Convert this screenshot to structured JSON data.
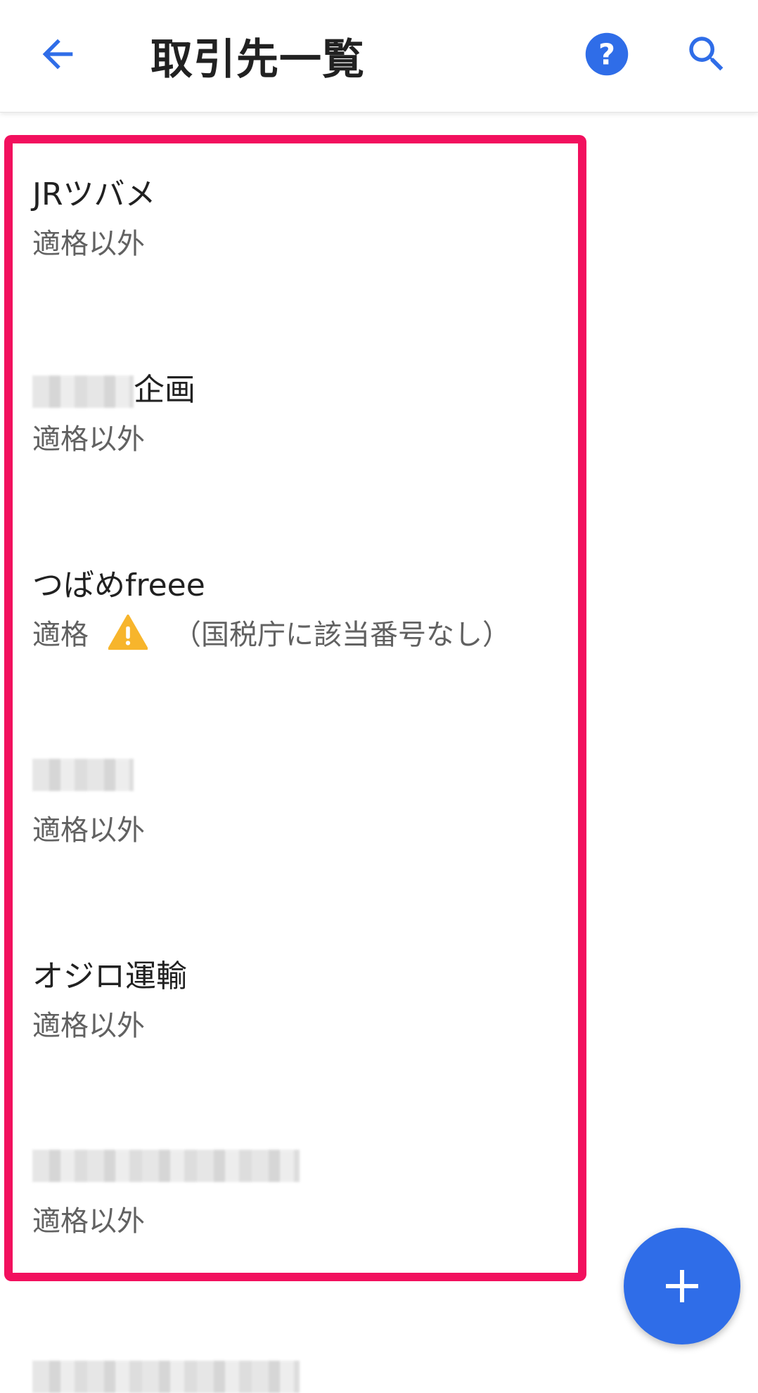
{
  "header": {
    "title": "取引先一覧"
  },
  "items": [
    {
      "name": "JRツバメ",
      "status": "適格以外"
    },
    {
      "name_suffix": "企画",
      "status": "適格以外"
    },
    {
      "name": "つばめfreee",
      "status": "適格",
      "note": "（国税庁に該当番号なし）"
    },
    {
      "status": "適格以外"
    },
    {
      "name": "オジロ運輸",
      "status": "適格以外"
    },
    {
      "status": "適格以外"
    }
  ],
  "colors": {
    "accent": "#2f6de8",
    "highlight": "#f2105e",
    "warning": "#f7b52c"
  },
  "icons": [
    "arrow-back-icon",
    "help-icon",
    "search-icon",
    "warning-icon",
    "plus-icon"
  ]
}
